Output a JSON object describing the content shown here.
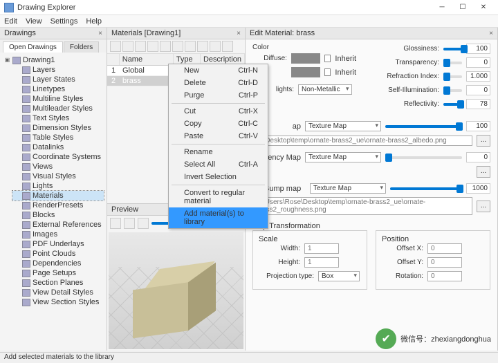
{
  "window": {
    "title": "Drawing Explorer"
  },
  "menu": [
    "Edit",
    "View",
    "Settings",
    "Help"
  ],
  "panels": {
    "drawings": "Drawings",
    "materials": "Materials [Drawing1]",
    "edit": "Edit Material: brass",
    "preview": "Preview"
  },
  "tabs": {
    "open": "Open Drawings",
    "folders": "Folders"
  },
  "tree": {
    "root": "Drawing1",
    "items": [
      "Layers",
      "Layer States",
      "Linetypes",
      "Multiline Styles",
      "Multileader Styles",
      "Text Styles",
      "Dimension Styles",
      "Table Styles",
      "Datalinks",
      "Coordinate Systems",
      "Views",
      "Visual Styles",
      "Lights",
      "Materials",
      "RenderPresets",
      "Blocks",
      "External References",
      "Images",
      "PDF Underlays",
      "Point Clouds",
      "Dependencies",
      "Page Setups",
      "Section Planes",
      "View Detail Styles",
      "View Section Styles"
    ]
  },
  "cols": {
    "num": "",
    "name": "Name",
    "type": "Type",
    "desc": "Description"
  },
  "rows": [
    {
      "n": "1",
      "name": "Global"
    },
    {
      "n": "2",
      "name": "brass"
    }
  ],
  "ctx": {
    "new": "New",
    "delete": "Delete",
    "purge": "Purge",
    "cut": "Cut",
    "copy": "Copy",
    "paste": "Paste",
    "rename": "Rename",
    "selall": "Select All",
    "invert": "Invert Selection",
    "convert": "Convert to regular material",
    "add": "Add material(s) to library",
    "k_new": "Ctrl-N",
    "k_del": "Ctrl-D",
    "k_purge": "Ctrl-P",
    "k_cut": "Ctrl-X",
    "k_copy": "Ctrl-C",
    "k_paste": "Ctrl-V",
    "k_sel": "Ctrl-A"
  },
  "props": {
    "color": "Color",
    "diffuse": "Diffuse:",
    "inherit": "Inherit",
    "lights": "lights:",
    "nonmet": "Non-Metallic",
    "gloss": "Glossiness:",
    "trans": "Transparency:",
    "refr": "Refraction Index:",
    "self": "Self-Illumination:",
    "refl": "Reflectivity:",
    "g": "100",
    "t": "0",
    "ri": "1.000",
    "si": "0",
    "rf": "78"
  },
  "maps": {
    "map": "ap",
    "texmap": "Texture Map",
    "val": "100",
    "path1": "se\\Desktop\\temp\\ornate-brass2_ue\\ornate-brass2_albedo.png",
    "path2": "C:\\Users\\Rose\\Desktop\\temp\\ornate-brass2_ue\\ornate-brass2_roughness.png",
    "emap": "ency Map",
    "bump": "Bump map",
    "v0": "0",
    "v1000": "1000"
  },
  "xf": {
    "title": "Map Transformation",
    "scale": "Scale",
    "pos": "Position",
    "w": "Width:",
    "h": "Height:",
    "proj": "Projection type:",
    "box": "Box",
    "ox": "Offset X:",
    "oy": "Offset Y:",
    "rot": "Rotation:",
    "one": "1",
    "zero": "0"
  },
  "preview": {
    "val": "100"
  },
  "status": "Add selected materials to the library",
  "wm": "微信号：zhexiangdonghua"
}
